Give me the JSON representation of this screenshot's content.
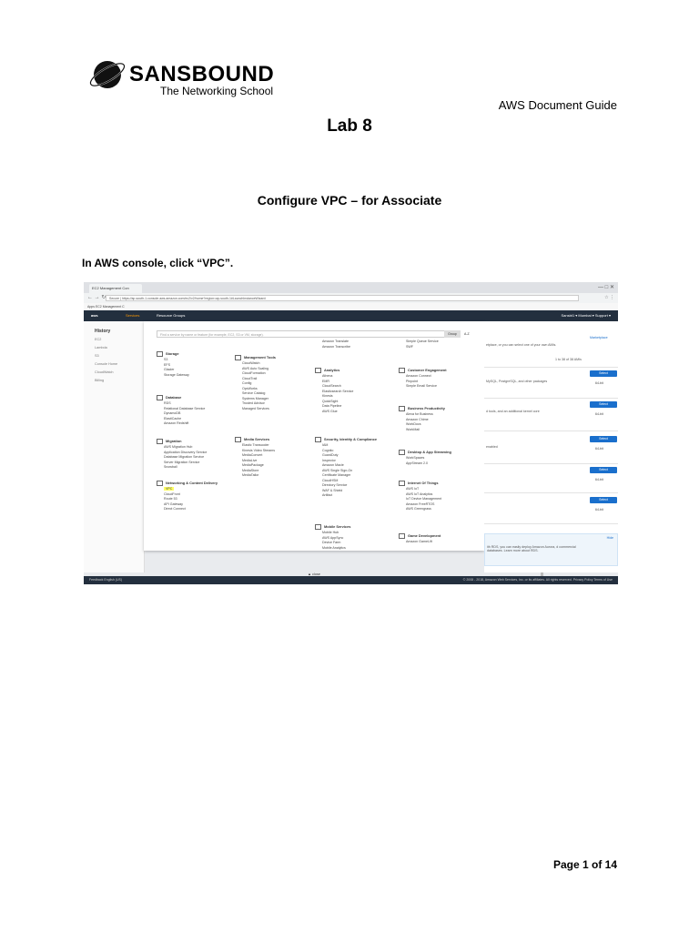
{
  "header": {
    "brand": "SANSBOUND",
    "tagline": "The Networking School",
    "doc_title": "AWS Document Guide"
  },
  "lab_title": "Lab 8",
  "subtitle": "Configure VPC – for Associate",
  "instruction": "In AWS console, click “VPC”.",
  "page_number": "Page 1 of 14",
  "screenshot": {
    "tab_title": "EC2 Management Con",
    "url": "Secure | https://ap-south-1.console.aws.amazon.com/ec2/v2/home?region=ap-south-1#LaunchInstanceWizard:",
    "bookmarks": "Apps   EC2 Management C",
    "nav": {
      "logo": "aws",
      "services": "Services",
      "resource_groups": "Resource Groups",
      "right": "Sansbt1 ▾   Mumbai ▾   Support ▾"
    },
    "history": {
      "title": "History",
      "items": [
        "EC2",
        "Lambda",
        "S3",
        "Console Home",
        "CloudWatch",
        "Billing"
      ]
    },
    "search_placeholder": "Find a service by name or feature (for example, EC2, S3 or VM, storage).",
    "group_label": "Group",
    "az_label": "A-Z",
    "categories": [
      {
        "title": "Storage",
        "items": [
          "S3",
          "EFS",
          "Glacier",
          "Storage Gateway"
        ]
      },
      {
        "title": "Database",
        "items": [
          "RDS",
          "Relational Database Service",
          "DynamoDB",
          "ElastiCache",
          "Amazon Redshift"
        ]
      },
      {
        "title": "Migration",
        "items": [
          "AWS Migration Hub",
          "Application Discovery Service",
          "Database Migration Service",
          "Server Migration Service",
          "Snowball"
        ]
      },
      {
        "title": "Networking & Content Delivery",
        "items": [
          "VPC",
          "CloudFront",
          "Route 53",
          "API Gateway",
          "Direct Connect"
        ]
      },
      {
        "title": "Management Tools",
        "items": [
          "CloudWatch",
          "AWS Auto Scaling",
          "CloudFormation",
          "CloudTrail",
          "Config",
          "OpsWorks",
          "Service Catalog",
          "Systems Manager",
          "Trusted Advisor",
          "Managed Services"
        ]
      },
      {
        "title": "Media Services",
        "items": [
          "Elastic Transcoder",
          "Kinesis Video Streams",
          "MediaConvert",
          "MediaLive",
          "MediaPackage",
          "MediaStore",
          "MediaTailor"
        ]
      },
      {
        "title": "Analytics",
        "items": [
          "Athena",
          "EMR",
          "CloudSearch",
          "Elasticsearch Service",
          "Kinesis",
          "QuickSight",
          "Data Pipeline",
          "AWS Glue"
        ]
      },
      {
        "title": "Security, Identity & Compliance",
        "items": [
          "IAM",
          "Cognito",
          "GuardDuty",
          "Inspector",
          "Amazon Macie",
          "AWS Single Sign-On",
          "Certificate Manager",
          "CloudHSM",
          "Directory Service",
          "WAF & Shield",
          "Artifact"
        ]
      },
      {
        "title": "Mobile Services",
        "items": [
          "Mobile Hub",
          "AWS AppSync",
          "Device Farm",
          "Mobile Analytics"
        ]
      },
      {
        "title": "Customer Engagement",
        "items": [
          "Amazon Connect",
          "Pinpoint",
          "Simple Email Service"
        ]
      },
      {
        "title": "Business Productivity",
        "items": [
          "Alexa for Business",
          "Amazon Chime",
          "WorkDocs",
          "WorkMail"
        ]
      },
      {
        "title": "Desktop & App Streaming",
        "items": [
          "WorkSpaces",
          "AppStream 2.0"
        ]
      },
      {
        "title": "Internet Of Things",
        "items": [
          "AWS IoT",
          "AWS IoT Analytics",
          "IoT Device Management",
          "Amazon FreeRTOS",
          "AWS Greengrass"
        ]
      },
      {
        "title": "Game Development",
        "items": [
          "Amazon GameLift"
        ]
      }
    ],
    "misc_items": {
      "col3_top": [
        "Amazon Translate",
        "Amazon Transcribe"
      ],
      "col4_top": [
        "Simple Queue Service",
        "SWF"
      ]
    },
    "right_panel": {
      "link": "Marketplace",
      "line1": "etplace, or you can select one of your own AMIs.",
      "pager": "1 to 38 of 38 AMIs",
      "line2": "MySQL, PostgreSQL, and other packages",
      "line3": "d tools, and an additional kernel core",
      "line4": "enabled",
      "select_label": "Select",
      "arch_label": "64-bit",
      "info_title": "Hide",
      "info_text": "ith RDS, you can easily deploy Amazon Aurora, d commercial databases. Learn more about RDS."
    },
    "close_label": "▲ close",
    "footer_left": "Feedback   English (US)",
    "footer_right": "© 2008 - 2018, Amazon Web Services, Inc. or its affiliates. All rights reserved.   Privacy Policy   Terms of Use"
  }
}
